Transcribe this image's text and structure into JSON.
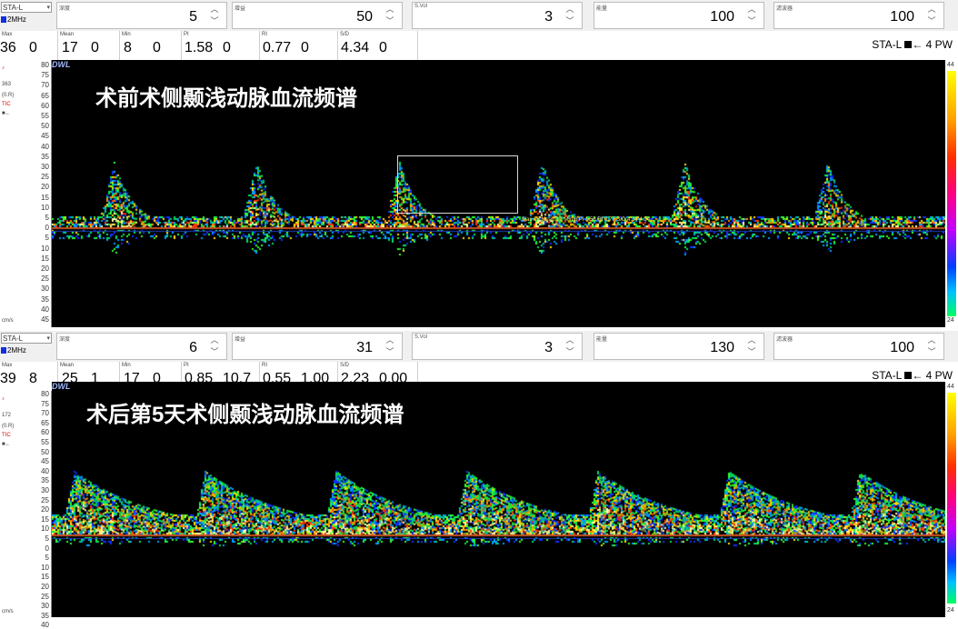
{
  "panels": [
    {
      "probe": {
        "location": "STA-L",
        "freq": "2MHz"
      },
      "params": [
        {
          "label": "深度",
          "value": "5"
        },
        {
          "label": "增益",
          "value": "50"
        },
        {
          "label": "S.Vol",
          "value": "3"
        },
        {
          "label": "能量",
          "value": "100"
        },
        {
          "label": "滤波器",
          "value": "100"
        }
      ],
      "measurements": {
        "max": {
          "label": "Max",
          "v1": "36",
          "v2": "0"
        },
        "mean": {
          "label": "Mean",
          "v1": "17",
          "v2": "0"
        },
        "min": {
          "label": "Min",
          "v1": "8",
          "v2": "0"
        },
        "pi": {
          "label": "PI",
          "v1": "1.58",
          "v2": "0"
        },
        "ri": {
          "label": "RI",
          "v1": "0.77",
          "v2": "0"
        },
        "sd": {
          "label": "S/D",
          "v1": "4.34",
          "v2": "0"
        }
      },
      "mode": {
        "text": "STA-L",
        "arrow": "←",
        "suffix": "4 PW"
      },
      "left_strip": {
        "value": "363",
        "unit": "(0.R)",
        "tag": "TIC"
      },
      "y_ticks": [
        "80",
        "75",
        "70",
        "65",
        "60",
        "55",
        "50",
        "45",
        "40",
        "35",
        "30",
        "25",
        "20",
        "15",
        "10",
        "5",
        "0",
        "5",
        "10",
        "15",
        "20",
        "25",
        "30",
        "35",
        "40",
        "45"
      ],
      "axis_unit": "cm/s",
      "logo": "DWL",
      "title": "术前术侧颞浅动脉血流频谱",
      "overlay": "Max 36 Mean 17 Min 8 PI 1.58 RI 0.77 S/D 4.34 4.34",
      "colorbar": {
        "top": "44",
        "bottom": "24"
      }
    },
    {
      "probe": {
        "location": "STA-L",
        "freq": "2MHz"
      },
      "params": [
        {
          "label": "深度",
          "value": "6"
        },
        {
          "label": "增益",
          "value": "31"
        },
        {
          "label": "S.Vol",
          "value": "3"
        },
        {
          "label": "能量",
          "value": "130"
        },
        {
          "label": "滤波器",
          "value": "100"
        }
      ],
      "measurements": {
        "max": {
          "label": "Max",
          "v1": "39",
          "v2": "8"
        },
        "mean": {
          "label": "Mean",
          "v1": "25",
          "v2": "1"
        },
        "min": {
          "label": "Min",
          "v1": "17",
          "v2": "0"
        },
        "pi": {
          "label": "PI",
          "v1": "0.85",
          "v2": "10.7"
        },
        "ri": {
          "label": "RI",
          "v1": "0.55",
          "v2": "1.00"
        },
        "sd": {
          "label": "S/D",
          "v1": "2.23",
          "v2": "0.00"
        }
      },
      "mode": {
        "text": "STA-L",
        "arrow": "←",
        "suffix": "4 PW"
      },
      "left_strip": {
        "value": "172",
        "unit": "(0.R)",
        "tag": "TIC"
      },
      "y_ticks": [
        "80",
        "75",
        "70",
        "65",
        "60",
        "55",
        "50",
        "45",
        "40",
        "35",
        "30",
        "25",
        "20",
        "15",
        "10",
        "5",
        "0",
        "5",
        "10",
        "15",
        "20",
        "25",
        "30",
        "35",
        "40"
      ],
      "axis_unit": "cm/s",
      "logo": "DWL",
      "title": "术后第5天术侧颞浅动脉血流频谱",
      "colorbar": {
        "top": "44",
        "bottom": "24"
      }
    }
  ],
  "colors": {
    "spectrum_bg": "#000000",
    "title": "#ffffff",
    "baseline": "#c85020",
    "overlay": "#ffe060"
  }
}
